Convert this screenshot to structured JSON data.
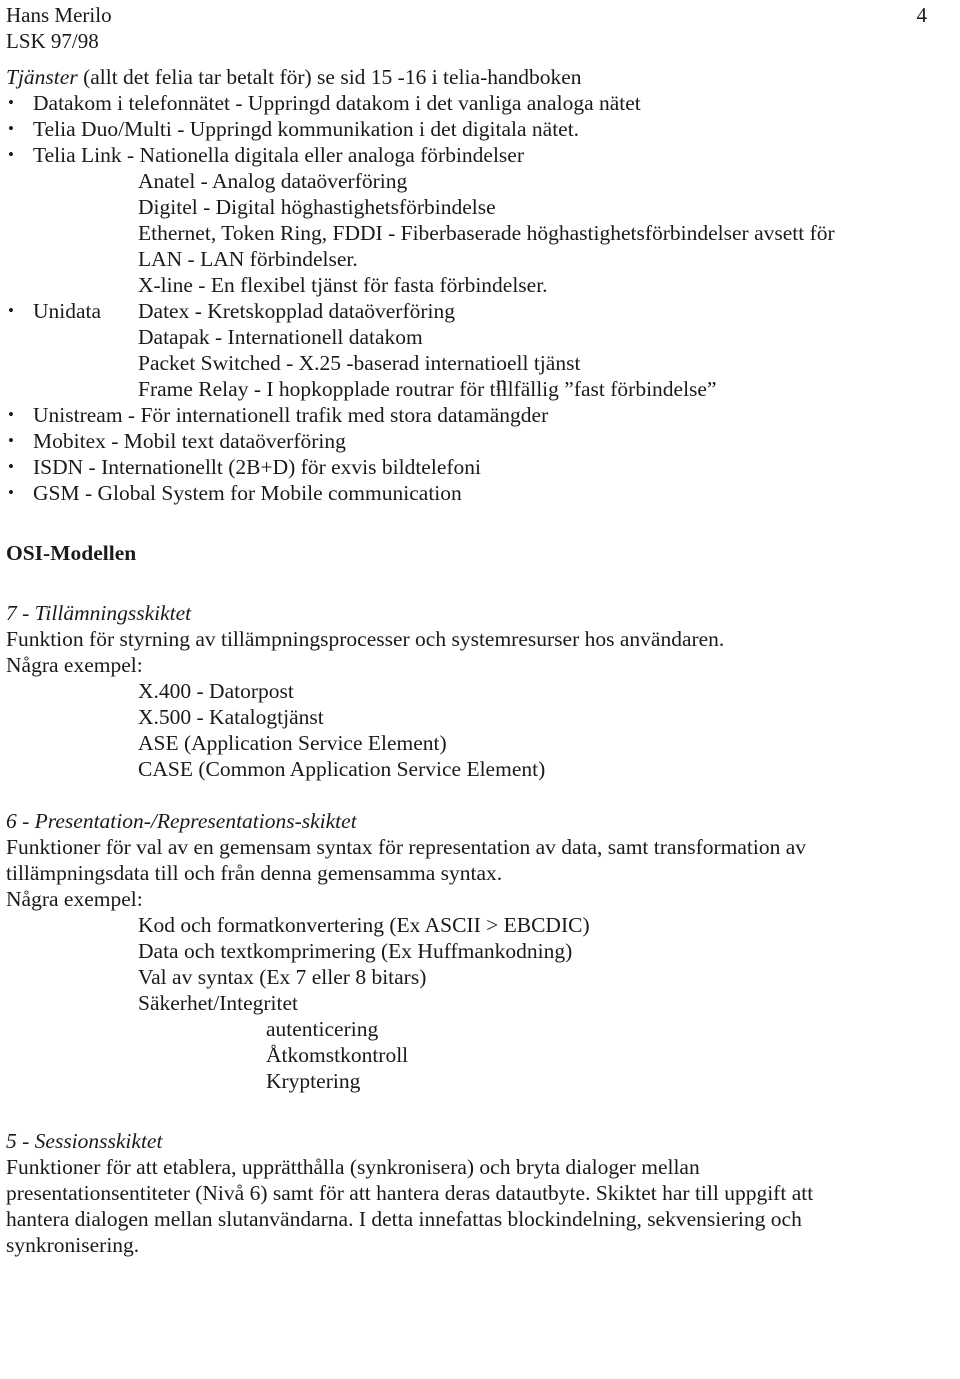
{
  "header": {
    "author": "Hans Merilo",
    "course": "LSK 97/98",
    "page_number": "4"
  },
  "services_section": {
    "heading_italic": "Tjänster",
    "heading_rest": " (allt det felia tar betalt för) se sid 15 -16 i telia-handboken",
    "bullets": [
      "Datakom i telefonnätet - Uppringd datakom i det vanliga analoga nätet",
      "Telia Duo/Multi - Uppringd kommunikation i det digitala nätet.",
      "Telia Link - Nationella digitala eller analoga förbindelser"
    ],
    "telia_link_sub": [
      "Anatel - Analog dataöverföring",
      "Digitel - Digital höghastighetsförbindelse",
      "Ethernet, Token Ring, FDDI - Fiberbaserade höghastighetsförbindelser avsett för",
      "LAN - LAN förbindelser.",
      "X-line - En flexibel tjänst för fasta förbindelser."
    ],
    "unidata": {
      "label": "Unidata",
      "first_line": "Datex - Kretskopplad dataöverföring",
      "sub": [
        "Datapak - Internationell datakom",
        "Frame Relay - I hopkopplade routrar för tillfällig ”fast förbindelse”"
      ],
      "packet_switched_prefix": "Packet Switched - X.25 -baserad internatio",
      "packet_switched_overlap": "n",
      "packet_switched_suffix": "ell tjänst"
    },
    "bullets_tail": [
      "Unistream - För internationell trafik med stora datamängder",
      "Mobitex - Mobil text dataöverföring",
      "ISDN - Internationellt (2B+D) för exvis bildtelefoni",
      "GSM - Global System for Mobile communication"
    ]
  },
  "osi": {
    "title": "OSI-Modellen",
    "layers": [
      {
        "heading": "7 - Tillämningsskiktet",
        "paragraph_lines": [
          "Funktion för styrning av tillämpningsprocesser och systemresurser hos användaren.",
          "Några exempel:"
        ],
        "examples": [
          "X.400 - Datorpost",
          "X.500 - Katalogtjänst",
          "ASE (Application Service Element)",
          "CASE (Common Application Service Element)"
        ],
        "examples_sub": []
      },
      {
        "heading": "6 - Presentation-/Representations-skiktet",
        "paragraph_lines": [
          "Funktioner för val av en gemensam syntax för representation av data, samt transformation av",
          "tillämpningsdata till och från denna gemensamma syntax.",
          "Några exempel:"
        ],
        "examples": [
          "Kod och formatkonvertering (Ex ASCII > EBCDIC)",
          "Data och textkomprimering (Ex Huffmankodning)",
          "Val av syntax (Ex 7 eller 8 bitars)",
          "Säkerhet/Integritet"
        ],
        "examples_sub": [
          "autenticering",
          "Åtkomstkontroll",
          "Kryptering"
        ]
      },
      {
        "heading": "5 - Sessionsskiktet",
        "paragraph_lines": [
          "Funktioner för att etablera, upprätthålla (synkronisera) och bryta dialoger mellan",
          "presentationsentiteter (Nivå 6) samt för att hantera deras datautbyte. Skiktet har till uppgift att",
          "hantera dialogen mellan slutanvändarna. I detta innefattas blockindelning, sekvensiering och",
          "synkronisering."
        ],
        "examples": [],
        "examples_sub": []
      }
    ]
  },
  "bullet_glyph": "•"
}
